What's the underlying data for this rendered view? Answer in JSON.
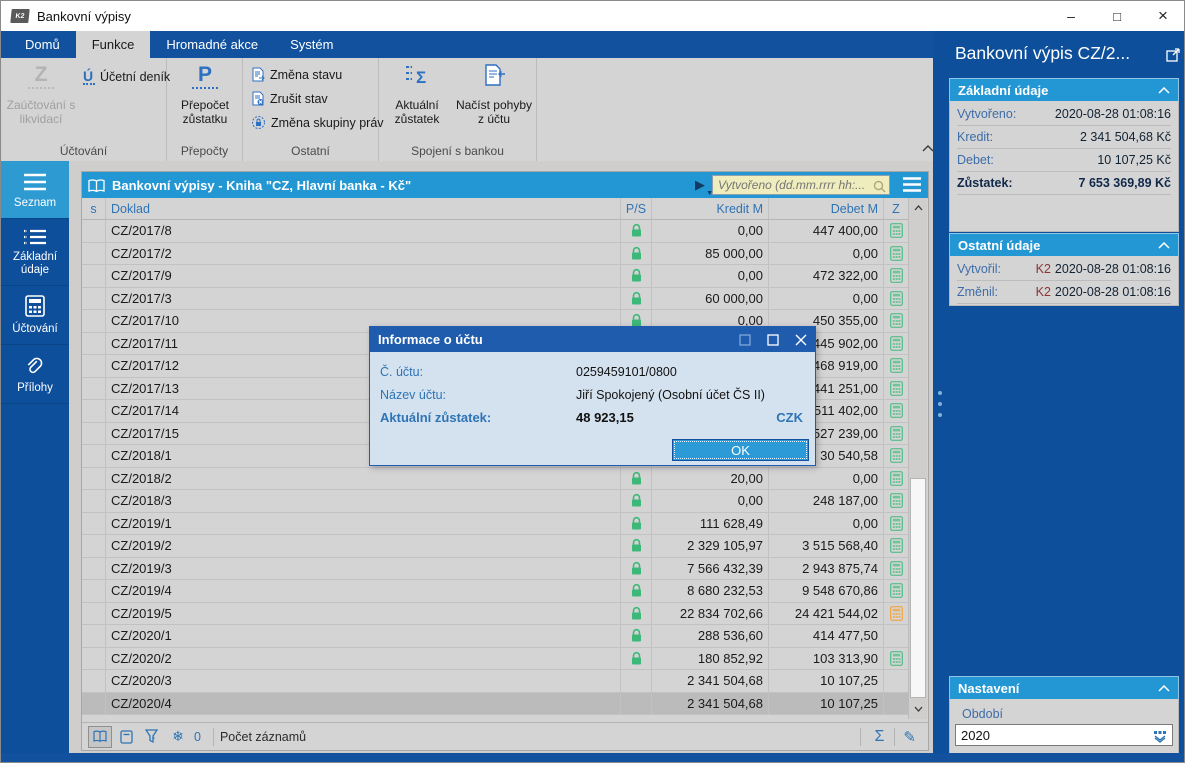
{
  "window": {
    "title": "Bankovní výpisy",
    "icon_text": "K2",
    "controls": {
      "minimize": "–",
      "maximize": "□",
      "close": "×"
    }
  },
  "ribbon": {
    "tabs": [
      {
        "label": "Domů",
        "active": false
      },
      {
        "label": "Funkce",
        "active": true
      },
      {
        "label": "Hromadné akce",
        "active": false
      },
      {
        "label": "Systém",
        "active": false
      }
    ],
    "groups": [
      {
        "label": "Účtování",
        "items": [
          {
            "label": "Zaúčtování s likvidací",
            "icon": "Z",
            "disabled": true
          },
          {
            "label": "Účetní deník",
            "icon": "Ú"
          }
        ]
      },
      {
        "label": "Přepočty",
        "items": [
          {
            "label": "Přepočet zůstatku",
            "icon": "P"
          }
        ]
      },
      {
        "label": "Ostatní",
        "items": [
          {
            "label": "Změna stavu"
          },
          {
            "label": "Zrušit stav"
          },
          {
            "label": "Změna skupiny práv"
          }
        ]
      },
      {
        "label": "Spojení s bankou",
        "items": [
          {
            "label": "Aktuální zůstatek"
          },
          {
            "label": "Načíst pohyby z účtu"
          }
        ]
      }
    ]
  },
  "sidebar": {
    "items": [
      {
        "label": "Seznam",
        "active": true
      },
      {
        "label": "Základní údaje",
        "active": false
      },
      {
        "label": "Účtování",
        "active": false
      },
      {
        "label": "Přílohy",
        "active": false
      }
    ]
  },
  "grid": {
    "title": "Bankovní výpisy - Kniha \"CZ, Hlavní banka - Kč\"",
    "filter_placeholder": "Vytvořeno (dd.mm.rrrr hh:...",
    "columns": [
      "s",
      "Doklad",
      "P/S",
      "Kredit M",
      "Debet M",
      "Z"
    ],
    "rows": [
      {
        "doc": "CZ/2017/8",
        "lock": true,
        "kredit": "0,00",
        "debet": "447 400,00",
        "calc": "green",
        "selected": false
      },
      {
        "doc": "CZ/2017/2",
        "lock": true,
        "kredit": "85 000,00",
        "debet": "0,00",
        "calc": "green",
        "selected": false
      },
      {
        "doc": "CZ/2017/9",
        "lock": true,
        "kredit": "0,00",
        "debet": "472 322,00",
        "calc": "green",
        "selected": false
      },
      {
        "doc": "CZ/2017/3",
        "lock": true,
        "kredit": "60 000,00",
        "debet": "0,00",
        "calc": "green",
        "selected": false
      },
      {
        "doc": "CZ/2017/10",
        "lock": true,
        "kredit": "0,00",
        "debet": "450 355,00",
        "calc": "green",
        "selected": false
      },
      {
        "doc": "CZ/2017/11",
        "lock": true,
        "kredit": "",
        "debet": "445 902,00",
        "calc": "green",
        "selected": false
      },
      {
        "doc": "CZ/2017/12",
        "lock": true,
        "kredit": "",
        "debet": "468 919,00",
        "calc": "green",
        "selected": false
      },
      {
        "doc": "CZ/2017/13",
        "lock": true,
        "kredit": "",
        "debet": "441 251,00",
        "calc": "green",
        "selected": false
      },
      {
        "doc": "CZ/2017/14",
        "lock": true,
        "kredit": "",
        "debet": "511 402,00",
        "calc": "green",
        "selected": false
      },
      {
        "doc": "CZ/2017/15",
        "lock": true,
        "kredit": "",
        "debet": "527 239,00",
        "calc": "green",
        "selected": false
      },
      {
        "doc": "CZ/2018/1",
        "lock": true,
        "kredit": "",
        "debet": "30 540,58",
        "calc": "green",
        "selected": false
      },
      {
        "doc": "CZ/2018/2",
        "lock": true,
        "kredit": "20,00",
        "debet": "0,00",
        "calc": "green",
        "selected": false
      },
      {
        "doc": "CZ/2018/3",
        "lock": true,
        "kredit": "0,00",
        "debet": "248 187,00",
        "calc": "green",
        "selected": false
      },
      {
        "doc": "CZ/2019/1",
        "lock": true,
        "kredit": "111 628,49",
        "debet": "0,00",
        "calc": "green",
        "selected": false
      },
      {
        "doc": "CZ/2019/2",
        "lock": true,
        "kredit": "2 329 105,97",
        "debet": "3 515 568,40",
        "calc": "green",
        "selected": false
      },
      {
        "doc": "CZ/2019/3",
        "lock": true,
        "kredit": "7 566 432,39",
        "debet": "2 943 875,74",
        "calc": "green",
        "selected": false
      },
      {
        "doc": "CZ/2019/4",
        "lock": true,
        "kredit": "8 680 232,53",
        "debet": "9 548 670,86",
        "calc": "green",
        "selected": false
      },
      {
        "doc": "CZ/2019/5",
        "lock": true,
        "kredit": "22 834 702,66",
        "debet": "24 421 544,02",
        "calc": "orange",
        "selected": false
      },
      {
        "doc": "CZ/2020/1",
        "lock": true,
        "kredit": "288 536,60",
        "debet": "414 477,50",
        "calc": "none",
        "selected": false
      },
      {
        "doc": "CZ/2020/2",
        "lock": true,
        "kredit": "180 852,92",
        "debet": "103 313,90",
        "calc": "green",
        "selected": false
      },
      {
        "doc": "CZ/2020/3",
        "lock": false,
        "kredit": "2 341 504,68",
        "debet": "10 107,25",
        "calc": "none",
        "selected": false
      },
      {
        "doc": "CZ/2020/4",
        "lock": false,
        "kredit": "2 341 504,68",
        "debet": "10 107,25",
        "calc": "none",
        "selected": true
      }
    ],
    "status": {
      "frozen_count": "0",
      "records_label": "Počet záznamů",
      "sigma": "Σ",
      "pencil": "✎",
      "snowflake": "❄"
    },
    "play_icon": "▶",
    "play_caret": "▼"
  },
  "dialog": {
    "title": "Informace o účtu",
    "fields": [
      {
        "label": "Č. účtu:",
        "value": "0259459101/0800"
      },
      {
        "label": "Název účtu:",
        "value": "Jiří Spokojený (Osobní účet ČS II)"
      },
      {
        "label": "Aktuální zůstatek:",
        "value": "48 923,15",
        "suffix": "CZK"
      }
    ],
    "ok_label": "OK"
  },
  "detail_panel": {
    "title": "Bankovní výpis CZ/2...",
    "sections": [
      {
        "title": "Základní údaje",
        "rows": [
          {
            "label": "Vytvořeno:",
            "value": "2020-08-28 01:08:16"
          },
          {
            "label": "Kredit:",
            "value": "2 341 504,68 Kč"
          },
          {
            "label": "Debet:",
            "value": "10 107,25 Kč"
          },
          {
            "label": "Zůstatek:",
            "value": "7 653 369,89 Kč"
          }
        ]
      },
      {
        "title": "Ostatní údaje",
        "rows": [
          {
            "label": "Vytvořil:",
            "prefix": "K2",
            "value": "2020-08-28 01:08:16"
          },
          {
            "label": "Změnil:",
            "prefix": "K2",
            "value": "2020-08-28 01:08:16"
          }
        ]
      },
      {
        "title": "Nastavení"
      }
    ],
    "settings": {
      "period_label": "Období",
      "period_value": "2020"
    }
  },
  "colors": {
    "blue_dark": "#11519d",
    "blue_mid": "#2397d3",
    "green": "#3cb878",
    "orange": "#f2a33c",
    "gray_ui": "#d5d4d4",
    "dialog_body": "#d4e2f0"
  }
}
